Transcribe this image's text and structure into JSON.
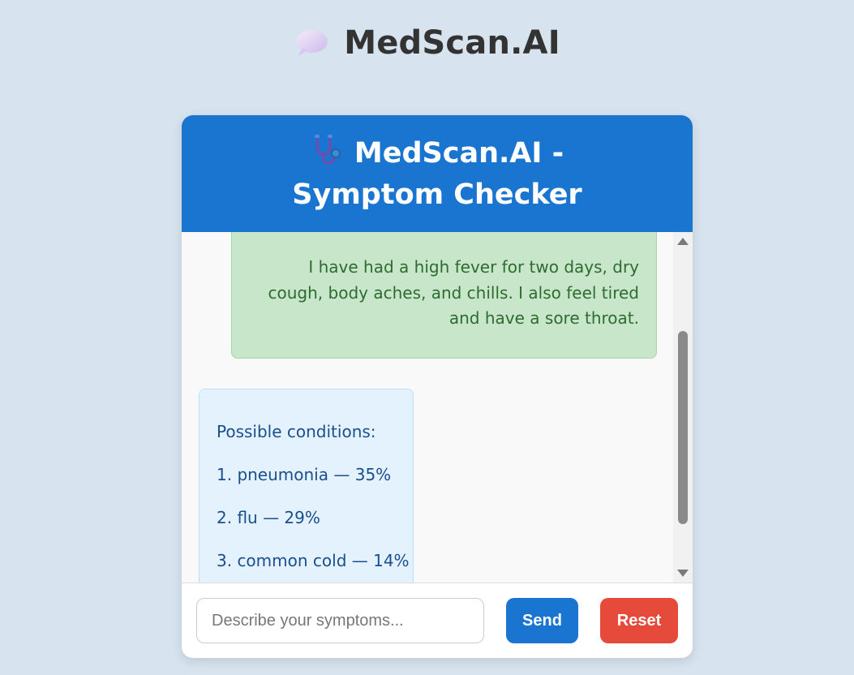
{
  "page": {
    "title": "MedScan.AI",
    "title_icon": "speech-bubble-icon"
  },
  "chat": {
    "header_title": "MedScan.AI - Symptom Checker",
    "header_icon": "stethoscope-icon",
    "user_message": "I have had a high fever for two days, dry cough, body aches, and chills. I also feel tired and have a sore throat.",
    "bot_message": {
      "intro": "Possible conditions:",
      "conditions": [
        "1. pneumonia — 35%",
        "2. flu — 29%",
        "3. common cold — 14%"
      ]
    }
  },
  "input": {
    "placeholder": "Describe your symptoms...",
    "value": ""
  },
  "buttons": {
    "send_label": "Send",
    "reset_label": "Reset"
  },
  "colors": {
    "background": "#d7e3ee",
    "header_blue": "#1a75d1",
    "user_bubble": "#c8e6c9",
    "bot_bubble": "#e3f2fd",
    "reset_red": "#e64a3b"
  }
}
